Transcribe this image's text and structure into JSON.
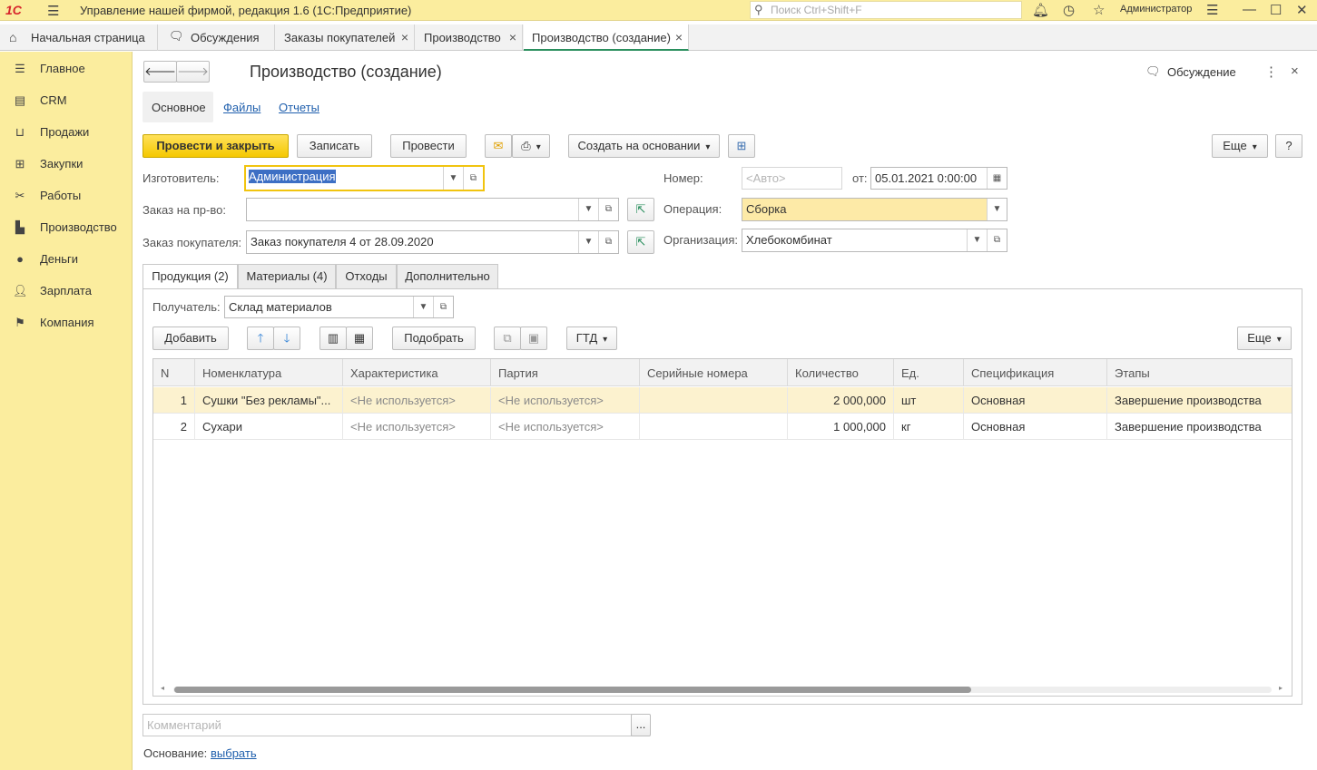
{
  "titlebar": {
    "logo": "1С",
    "app_title": "Управление нашей фирмой, редакция 1.6  (1С:Предприятие)",
    "search_placeholder": "Поиск Ctrl+Shift+F",
    "user": "Администратор"
  },
  "tabs": [
    {
      "label": "Начальная страница"
    },
    {
      "label": "Обсуждения"
    },
    {
      "label": "Заказы покупателей",
      "close": "×"
    },
    {
      "label": "Производство",
      "close": "×"
    },
    {
      "label": "Производство (создание)",
      "close": "×"
    }
  ],
  "sidebar": {
    "items": [
      {
        "label": "Главное",
        "icon": "menu-icon"
      },
      {
        "label": "CRM",
        "icon": "crm-icon"
      },
      {
        "label": "Продажи",
        "icon": "basket-icon"
      },
      {
        "label": "Закупки",
        "icon": "cart-icon"
      },
      {
        "label": "Работы",
        "icon": "tools-icon"
      },
      {
        "label": "Производство",
        "icon": "factory-icon"
      },
      {
        "label": "Деньги",
        "icon": "money-icon"
      },
      {
        "label": "Зарплата",
        "icon": "people-icon"
      },
      {
        "label": "Компания",
        "icon": "flag-icon"
      }
    ]
  },
  "form": {
    "title": "Производство (создание)",
    "discussion": "Обсуждение",
    "subtabs": {
      "main": "Основное",
      "files": "Файлы",
      "reports": "Отчеты"
    },
    "toolbar": {
      "post_close": "Провести и закрыть",
      "write": "Записать",
      "post": "Провести",
      "create_based": "Создать на основании",
      "more": "Еще",
      "help": "?"
    },
    "fields": {
      "manufacturer_label": "Изготовитель:",
      "manufacturer_value": "Администрация",
      "prod_order_label": "Заказ на пр-во:",
      "prod_order_value": "",
      "customer_order_label": "Заказ покупателя:",
      "customer_order_value": "Заказ покупателя 4 от 28.09.2020",
      "number_label": "Номер:",
      "number_placeholder": "<Авто>",
      "date_label": "от:",
      "date_value": "05.01.2021  0:00:00",
      "operation_label": "Операция:",
      "operation_value": "Сборка",
      "org_label": "Организация:",
      "org_value": "Хлебокомбинат"
    },
    "doc_tabs": [
      "Продукция (2)",
      "Материалы (4)",
      "Отходы",
      "Дополнительно"
    ],
    "recipient_label": "Получатель:",
    "recipient_value": "Склад материалов",
    "table_toolbar": {
      "add": "Добавить",
      "pick": "Подобрать",
      "gtd": "ГТД",
      "more": "Еще"
    },
    "table": {
      "headers": [
        "N",
        "Номенклатура",
        "Характеристика",
        "Партия",
        "Серийные номера",
        "Количество",
        "Ед.",
        "Спецификация",
        "Этапы"
      ],
      "rows": [
        [
          "1",
          "Сушки \"Без рекламы\"...",
          "<Не используется>",
          "<Не используется>",
          "",
          "2 000,000",
          "шт",
          "Основная",
          "Завершение производства"
        ],
        [
          "2",
          "Сухари",
          "<Не используется>",
          "<Не используется>",
          "",
          "1 000,000",
          "кг",
          "Основная",
          "Завершение производства"
        ]
      ]
    },
    "comment_placeholder": "Комментарий",
    "comment_btn": "...",
    "basis_label": "Основание:",
    "basis_link": "выбрать"
  }
}
